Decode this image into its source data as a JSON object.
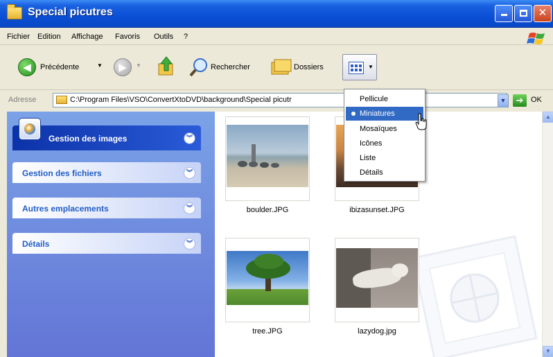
{
  "window": {
    "title": "Special picutres"
  },
  "menubar": {
    "items": [
      "Fichier",
      "Edition",
      "Affichage",
      "Favoris",
      "Outils",
      "?"
    ]
  },
  "toolbar": {
    "back_label": "Précédente",
    "search_label": "Rechercher",
    "folders_label": "Dossiers"
  },
  "address": {
    "label": "Adresse",
    "path": "C:\\Program Files\\VSO\\ConvertXtoDVD\\background\\Special picutr",
    "go_label": "OK"
  },
  "tasks": {
    "groups": [
      {
        "title": "Gestion des images"
      },
      {
        "title": "Gestion des fichiers"
      },
      {
        "title": "Autres emplacements"
      },
      {
        "title": "Détails"
      }
    ]
  },
  "files": [
    {
      "name": "boulder.JPG"
    },
    {
      "name": "ibizasunset.JPG"
    },
    {
      "name": "tree.JPG"
    },
    {
      "name": "lazydog.jpg"
    }
  ],
  "views_menu": {
    "items": [
      "Pellicule",
      "Miniatures",
      "Mosaïques",
      "Icônes",
      "Liste",
      "Détails"
    ],
    "selected": "Miniatures"
  },
  "colors": {
    "titlebar": "#0a4fd6",
    "taskpane": "#6f8fde",
    "selection": "#316ac5"
  }
}
